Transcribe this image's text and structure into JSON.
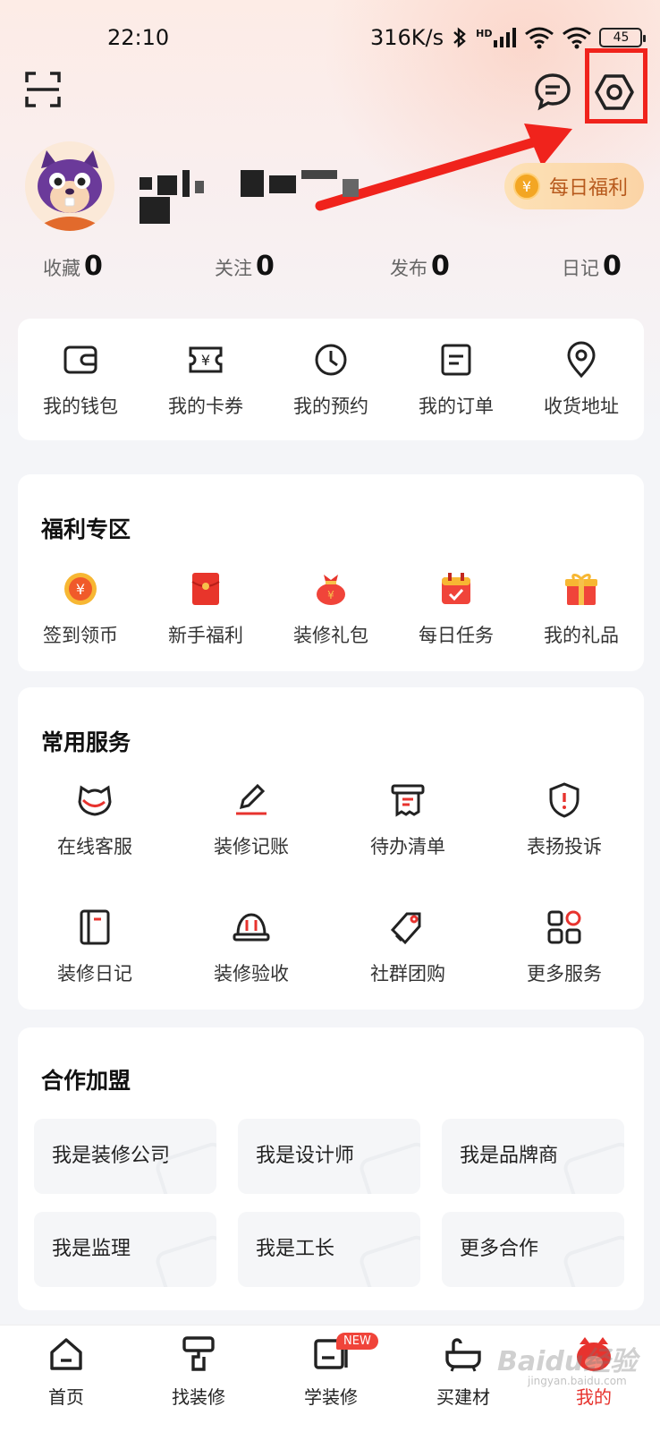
{
  "status_bar": {
    "time": "22:10",
    "network_speed": "316K/s",
    "network_type": "HD",
    "battery": "45"
  },
  "toolbar": {
    "scan_icon": "scan-icon",
    "message_icon": "message-icon",
    "settings_icon": "settings-icon"
  },
  "profile": {
    "username": "",
    "daily_benefit_label": "每日福利",
    "coin_symbol": "¥"
  },
  "stats": [
    {
      "label": "收藏",
      "value": "0"
    },
    {
      "label": "关注",
      "value": "0"
    },
    {
      "label": "发布",
      "value": "0"
    },
    {
      "label": "日记",
      "value": "0"
    }
  ],
  "quick_menu": [
    {
      "label": "我的钱包",
      "icon": "wallet-icon"
    },
    {
      "label": "我的卡券",
      "icon": "coupon-icon"
    },
    {
      "label": "我的预约",
      "icon": "clock-icon"
    },
    {
      "label": "我的订单",
      "icon": "order-icon"
    },
    {
      "label": "收货地址",
      "icon": "location-icon"
    }
  ],
  "welfare": {
    "title": "福利专区",
    "items": [
      {
        "label": "签到领币",
        "icon": "coin-icon"
      },
      {
        "label": "新手福利",
        "icon": "red-envelope-icon"
      },
      {
        "label": "装修礼包",
        "icon": "gift-bag-icon"
      },
      {
        "label": "每日任务",
        "icon": "calendar-check-icon"
      },
      {
        "label": "我的礼品",
        "icon": "gift-box-icon"
      }
    ]
  },
  "services": {
    "title": "常用服务",
    "items": [
      {
        "label": "在线客服",
        "icon": "customer-service-icon"
      },
      {
        "label": "装修记账",
        "icon": "pen-icon"
      },
      {
        "label": "待办清单",
        "icon": "receipt-icon"
      },
      {
        "label": "表扬投诉",
        "icon": "shield-alert-icon"
      },
      {
        "label": "装修日记",
        "icon": "notebook-icon"
      },
      {
        "label": "装修验收",
        "icon": "helmet-icon"
      },
      {
        "label": "社群团购",
        "icon": "tag-icon"
      },
      {
        "label": "更多服务",
        "icon": "grid-icon"
      }
    ]
  },
  "cooperation": {
    "title": "合作加盟",
    "items": [
      {
        "label": "我是装修公司"
      },
      {
        "label": "我是设计师"
      },
      {
        "label": "我是品牌商"
      },
      {
        "label": "我是监理"
      },
      {
        "label": "我是工长"
      },
      {
        "label": "更多合作"
      }
    ]
  },
  "bottom_nav": {
    "items": [
      {
        "label": "首页",
        "icon": "home-icon",
        "active": false
      },
      {
        "label": "找装修",
        "icon": "paint-roller-icon",
        "active": false
      },
      {
        "label": "学装修",
        "icon": "book-icon",
        "active": false,
        "badge": "NEW"
      },
      {
        "label": "买建材",
        "icon": "bathtub-icon",
        "active": false
      },
      {
        "label": "我的",
        "icon": "mascot-icon",
        "active": true
      }
    ]
  },
  "watermark": {
    "text": "Baidu经验",
    "sub": "jingyan.baidu.com"
  },
  "colors": {
    "accent": "#e7332e",
    "highlight": "#f0231c",
    "gold": "#f3a623",
    "daily_btn_text": "#b7591c"
  }
}
